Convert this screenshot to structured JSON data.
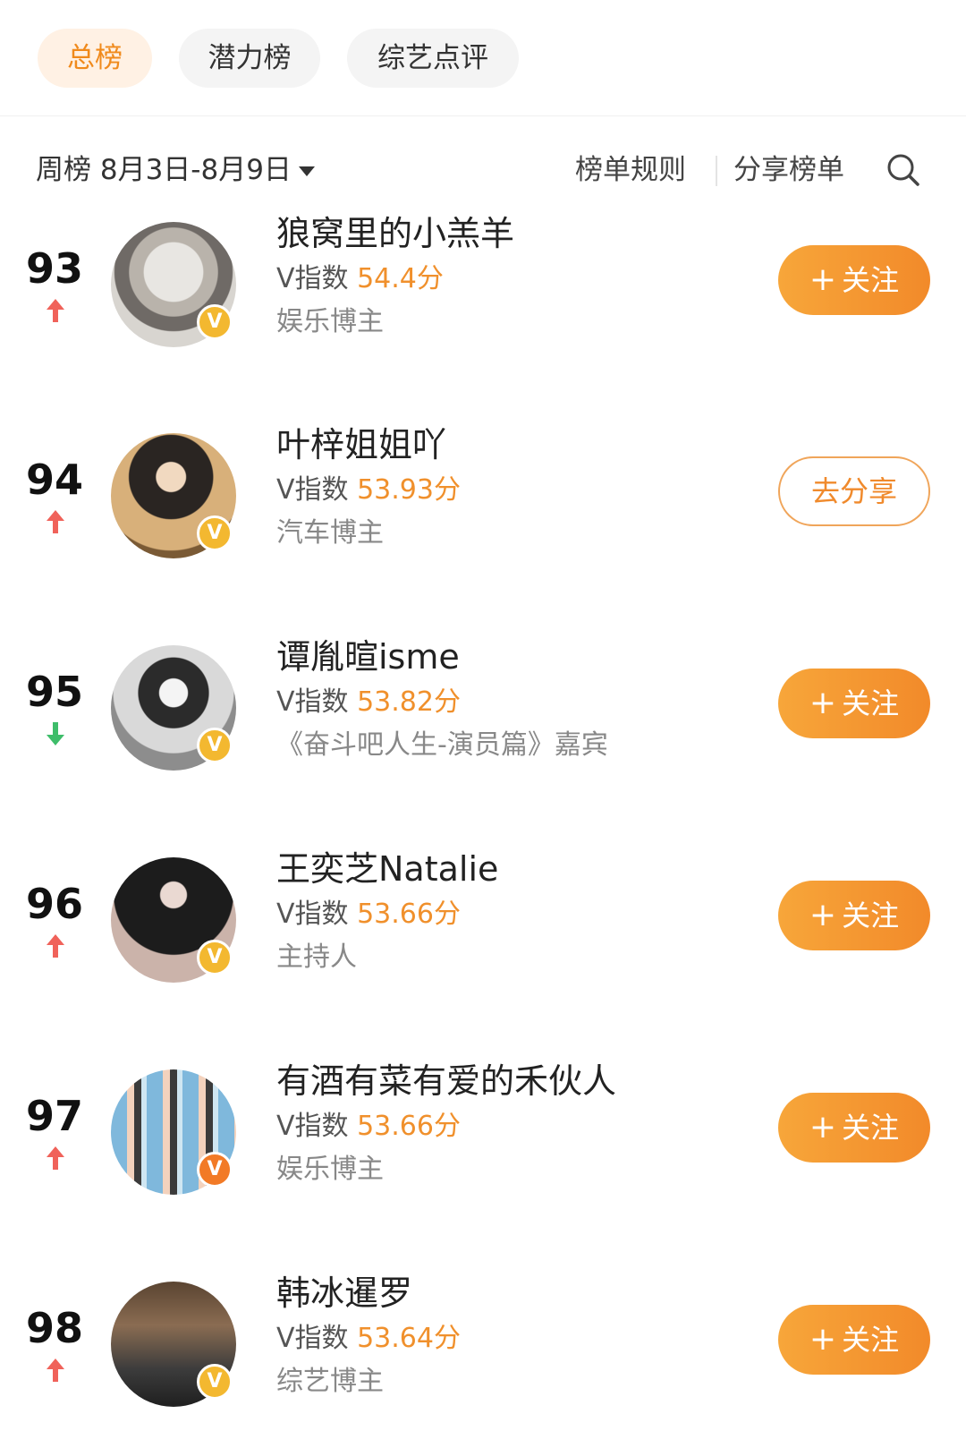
{
  "tabs": [
    {
      "label": "总榜",
      "active": true
    },
    {
      "label": "潜力榜",
      "active": false
    },
    {
      "label": "综艺点评",
      "active": false
    }
  ],
  "filter": {
    "period": "周榜 8月3日-8月9日",
    "rules_label": "榜单规则",
    "share_list_label": "分享榜单"
  },
  "icons": {
    "search": "search-icon",
    "caret": "caret-down-icon",
    "verified": "v-badge-icon"
  },
  "colors": {
    "accent": "#f08a1c",
    "score": "#f0902c",
    "up": "#f0625a",
    "down": "#3ebd6a",
    "badge": "#f3b830"
  },
  "entries": [
    {
      "rank": "93",
      "trend": "up",
      "name": "狼窝里的小羔羊",
      "v_prefix": "V指数",
      "score": "54.4分",
      "tag": "娱乐博主",
      "button": "关注",
      "button_type": "follow"
    },
    {
      "rank": "94",
      "trend": "up",
      "name": "叶梓姐姐吖",
      "v_prefix": "V指数",
      "score": "53.93分",
      "tag": "汽车博主",
      "button": "去分享",
      "button_type": "share"
    },
    {
      "rank": "95",
      "trend": "down",
      "name": "谭胤暄isme",
      "v_prefix": "V指数",
      "score": "53.82分",
      "tag": "《奋斗吧人生-演员篇》嘉宾",
      "button": "关注",
      "button_type": "follow"
    },
    {
      "rank": "96",
      "trend": "up",
      "name": "王奕芝Natalie",
      "v_prefix": "V指数",
      "score": "53.66分",
      "tag": "主持人",
      "button": "关注",
      "button_type": "follow"
    },
    {
      "rank": "97",
      "trend": "up",
      "name": "有酒有菜有爱的禾伙人",
      "v_prefix": "V指数",
      "score": "53.66分",
      "tag": "娱乐博主",
      "button": "关注",
      "button_type": "follow"
    },
    {
      "rank": "98",
      "trend": "up",
      "name": "韩冰暹罗",
      "v_prefix": "V指数",
      "score": "53.64分",
      "tag": "综艺博主",
      "button": "关注",
      "button_type": "follow"
    }
  ]
}
